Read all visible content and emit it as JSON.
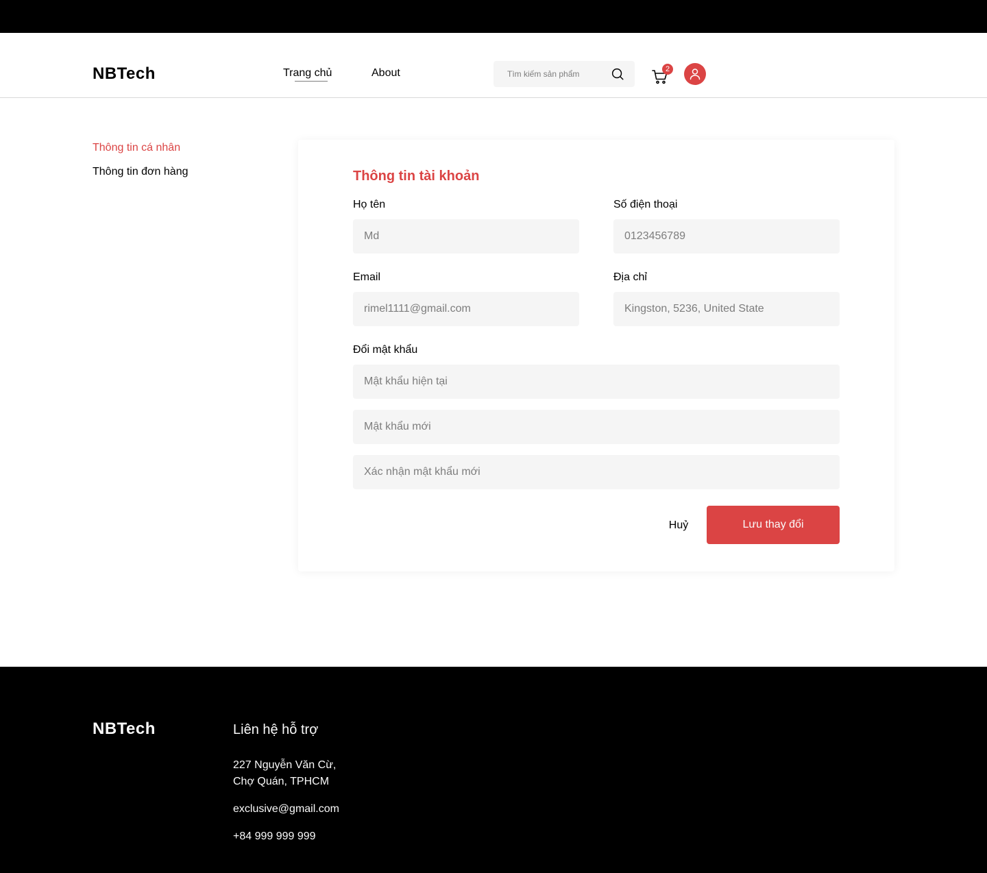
{
  "header": {
    "logo": "NBTech",
    "nav": {
      "home": "Trang chủ",
      "about": "About"
    },
    "search": {
      "placeholder": "Tìm kiếm sản phẩm"
    },
    "cart": {
      "count": "2"
    }
  },
  "sidebar": {
    "items": [
      {
        "label": "Thông tin cá nhân",
        "active": true
      },
      {
        "label": "Thông tin đơn hàng",
        "active": false
      }
    ]
  },
  "form": {
    "title": "Thông tin tài khoản",
    "fields": {
      "name": {
        "label": "Họ tên",
        "placeholder": "Md"
      },
      "phone": {
        "label": "Số điện thoại",
        "placeholder": "0123456789"
      },
      "email": {
        "label": "Email",
        "placeholder": "rimel1111@gmail.com"
      },
      "address": {
        "label": "Địa chỉ",
        "placeholder": "Kingston, 5236, United State"
      }
    },
    "password": {
      "label": "Đổi mật khẩu",
      "current_placeholder": "Mật khẩu hiện tại",
      "new_placeholder": "Mật khẩu mới",
      "confirm_placeholder": "Xác nhận mật khẩu mới"
    },
    "cancel_label": "Huỷ",
    "save_label": "Lưu thay đổi"
  },
  "footer": {
    "logo": "NBTech",
    "heading": "Liên hệ hỗ trợ",
    "address_line1": "227 Nguyễn Văn Cừ,",
    "address_line2": "Chợ Quán, TPHCM",
    "email": "exclusive@gmail.com",
    "phone": "+84 999 999 999"
  },
  "colors": {
    "accent": "#db4444",
    "input_bg": "#f5f5f5",
    "footer_bg": "#000000",
    "placeholder": "#7d7d7d"
  },
  "icons": [
    "search-icon",
    "cart-icon",
    "user-icon"
  ]
}
